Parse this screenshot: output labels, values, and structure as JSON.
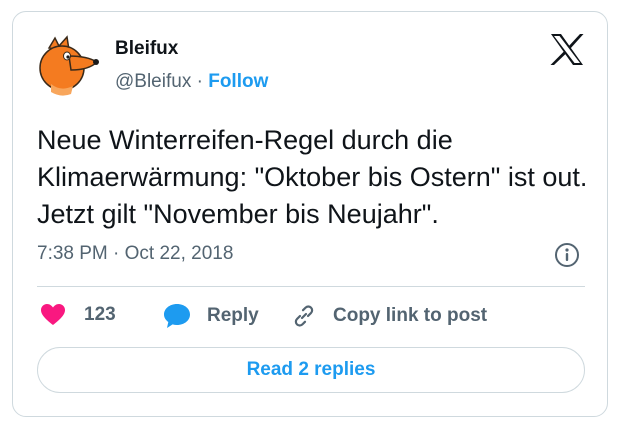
{
  "author": {
    "name": "Bleifux",
    "handle": "@Bleifux",
    "separator": "·",
    "follow_label": "Follow",
    "avatar_icon": "fox-avatar-icon"
  },
  "brand_icon": "x-logo-icon",
  "tweet": {
    "text": "Neue Winterreifen-Regel durch die Klimaerwärmung: \"Oktober bis Ostern\" ist out. Jetzt gilt \"November bis Neujahr\".",
    "timestamp": "7:38 PM · Oct 22, 2018"
  },
  "actions": {
    "like_count": "123",
    "reply_label": "Reply",
    "copy_label": "Copy link to post"
  },
  "read_replies_label": "Read 2 replies",
  "colors": {
    "accent": "#1d9bf0",
    "like": "#f91880",
    "text": "#0f1419",
    "muted": "#536471",
    "border": "#cfd9de",
    "avatar_orange": "#f47b20"
  }
}
